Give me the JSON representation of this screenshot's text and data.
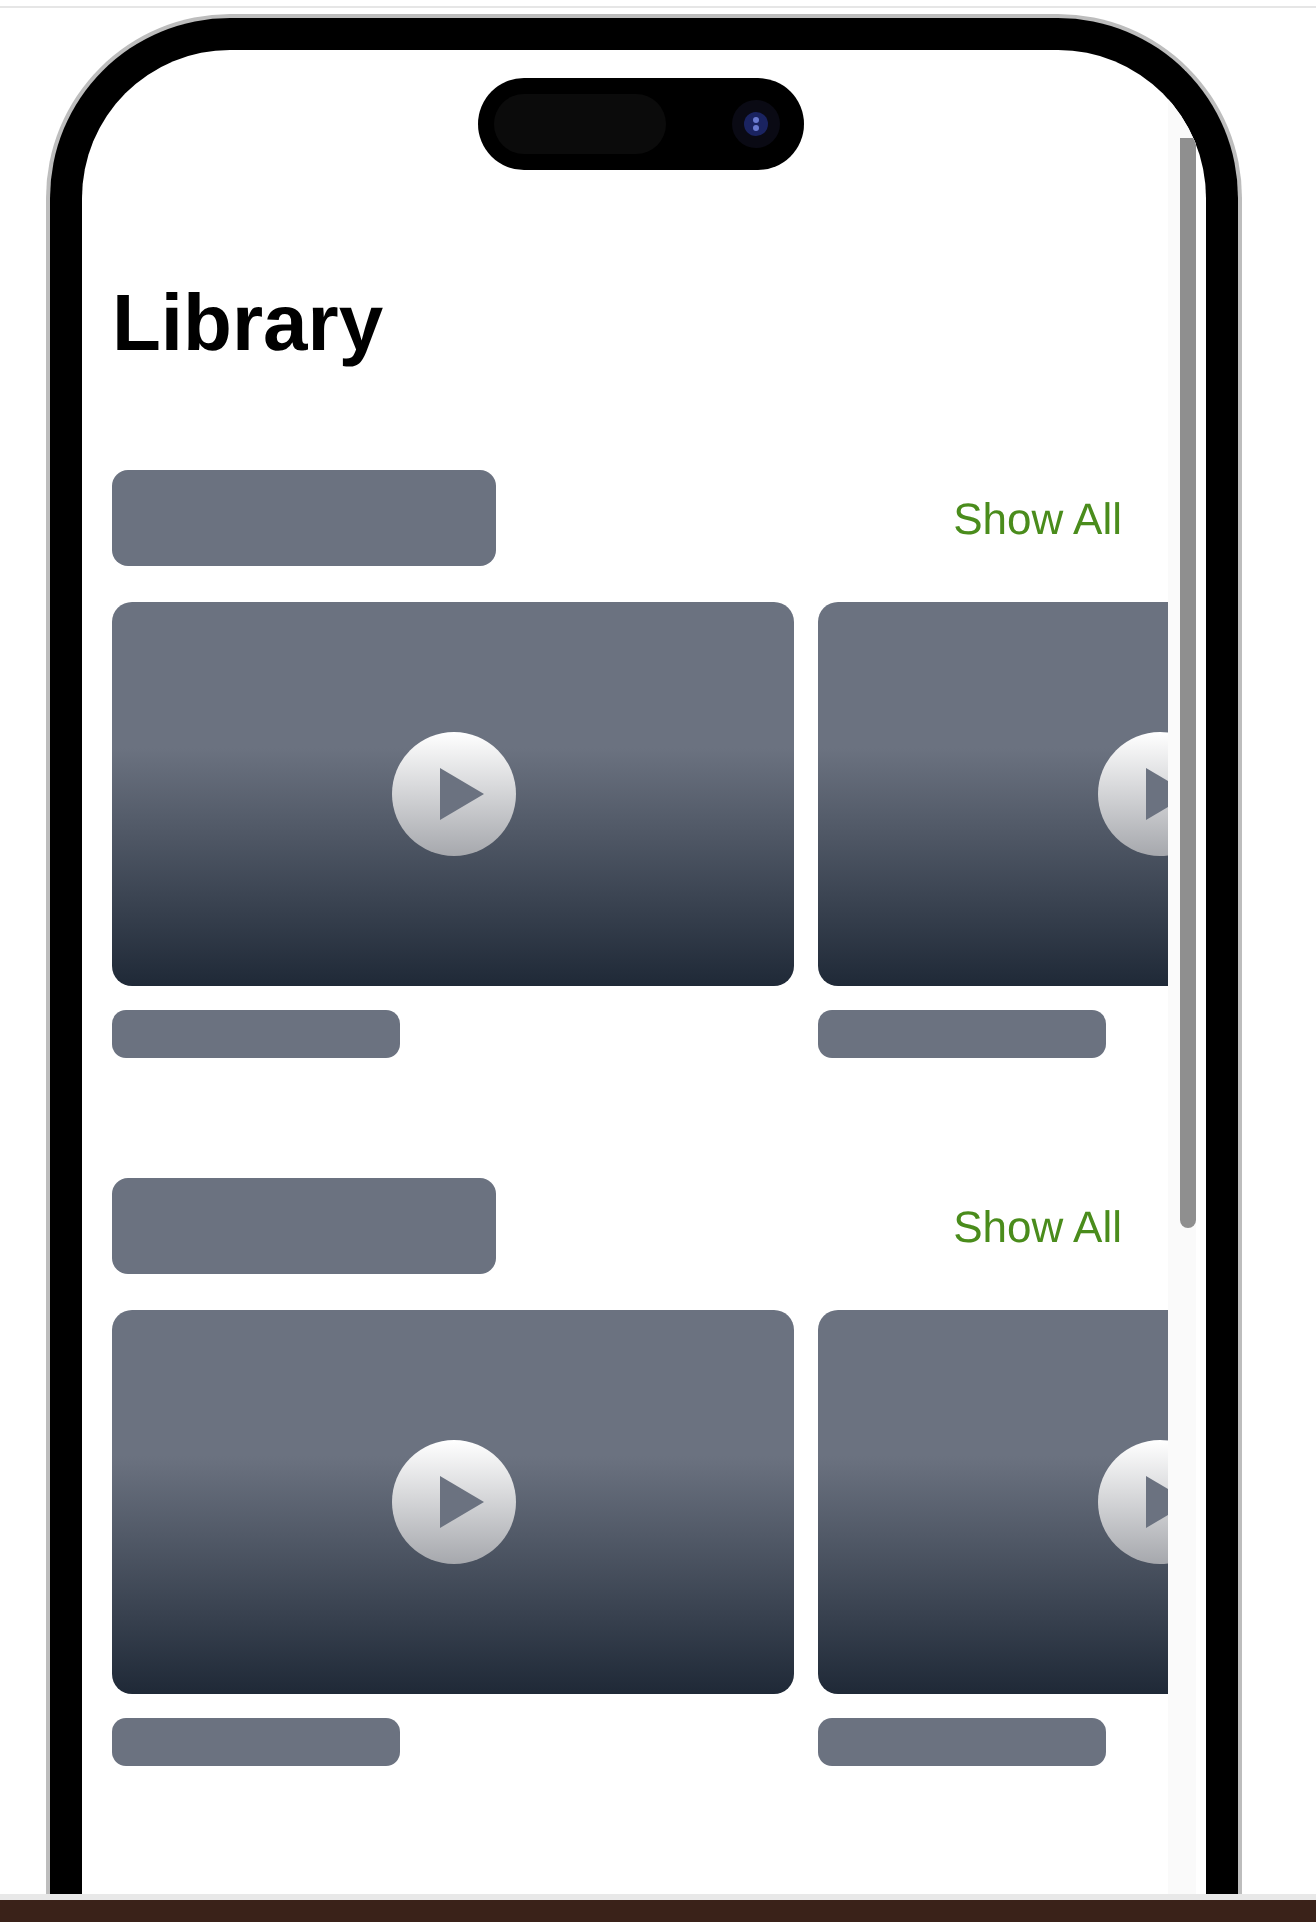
{
  "title": "Library",
  "sections": [
    {
      "heading": {
        "kind": "placeholder"
      },
      "show_all": "Show All",
      "cards": [
        {
          "kind": "video"
        },
        {
          "kind": "video"
        }
      ]
    },
    {
      "heading": {
        "kind": "placeholder"
      },
      "show_all": "Show All",
      "cards": [
        {
          "kind": "video"
        },
        {
          "kind": "video"
        }
      ]
    }
  ]
}
